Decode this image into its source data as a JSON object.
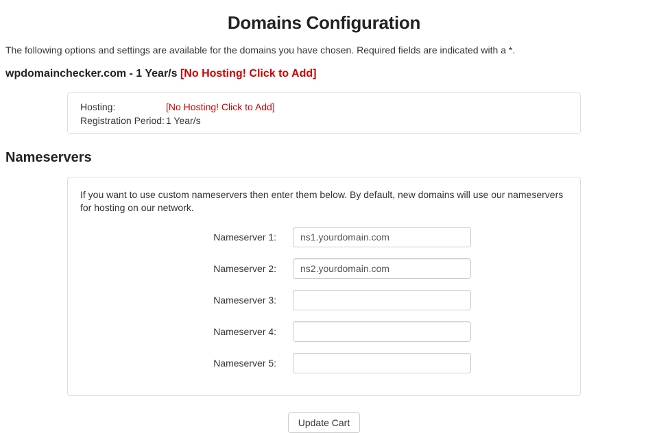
{
  "header": {
    "title": "Domains Configuration",
    "intro": "The following options and settings are available for the domains you have chosen. Required fields are indicated with a *."
  },
  "domain": {
    "name": "wpdomainchecker.com",
    "period_short": "1 Year/s",
    "no_hosting_badge": "[No Hosting! Click to Add]",
    "details": {
      "hosting_label": "Hosting:",
      "hosting_value": "[No Hosting! Click to Add]",
      "reg_period_label": "Registration Period:",
      "reg_period_value": "1 Year/s"
    }
  },
  "nameservers": {
    "heading": "Nameservers",
    "desc": "If you want to use custom nameservers then enter them below. By default, new domains will use our nameservers for hosting on our network.",
    "rows": [
      {
        "label": "Nameserver 1:",
        "value": "ns1.yourdomain.com"
      },
      {
        "label": "Nameserver 2:",
        "value": "ns2.yourdomain.com"
      },
      {
        "label": "Nameserver 3:",
        "value": ""
      },
      {
        "label": "Nameserver 4:",
        "value": ""
      },
      {
        "label": "Nameserver 5:",
        "value": ""
      }
    ]
  },
  "actions": {
    "update_cart": "Update Cart"
  }
}
